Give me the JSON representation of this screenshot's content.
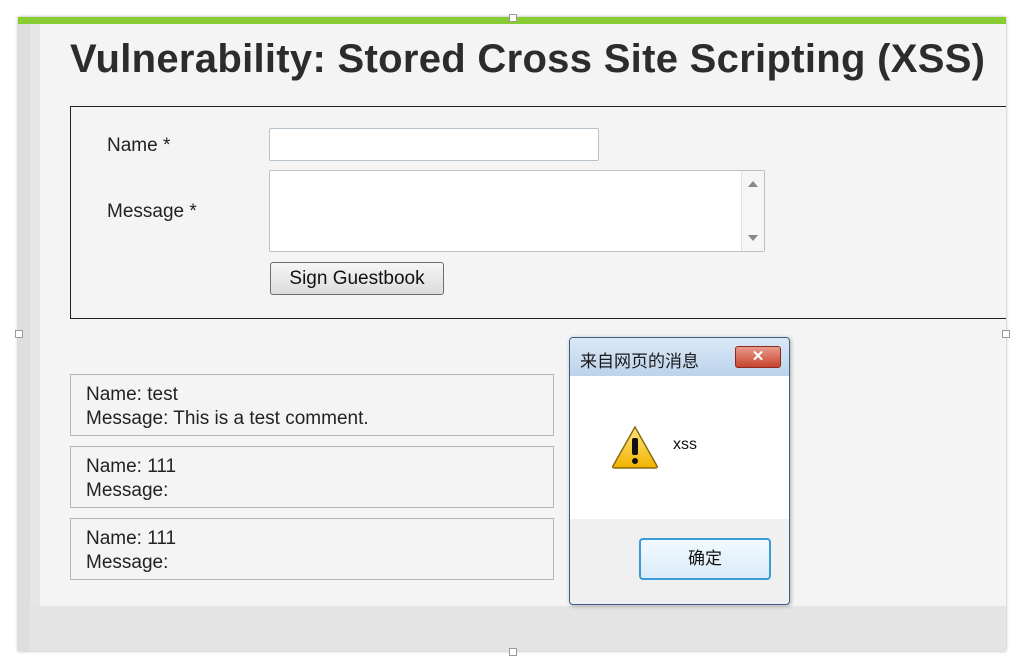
{
  "page": {
    "title": "Vulnerability: Stored Cross Site Scripting (XSS)"
  },
  "form": {
    "name_label": "Name *",
    "message_label": "Message *",
    "name_value": "",
    "message_value": "",
    "submit_label": "Sign Guestbook"
  },
  "entries": [
    {
      "name": "Name: test",
      "message": "Message: This is a test comment."
    },
    {
      "name": "Name: 111",
      "message": "Message:"
    },
    {
      "name": "Name: 111",
      "message": "Message:"
    }
  ],
  "dialog": {
    "title": "来自网页的消息",
    "close_glyph": "✕",
    "message": "xss",
    "icon": "warning-icon",
    "ok_label": "确定"
  },
  "colors": {
    "accent_bar": "#86cc32",
    "dialog_ok_border": "#3c9ad6",
    "close_button": "#c8442e"
  }
}
